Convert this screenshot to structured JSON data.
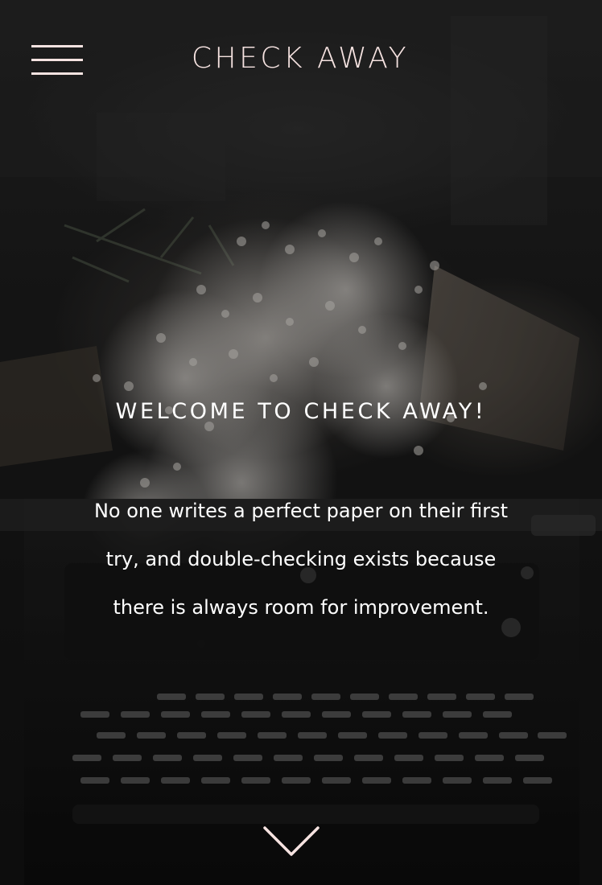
{
  "header": {
    "site_title": "CHECK AWAY",
    "menu_icon": "hamburger-menu-icon"
  },
  "hero": {
    "heading": "WELCOME TO CHECK AWAY!",
    "intro_lines": [
      "No one writes a perfect paper on their first",
      "try, and double-checking exists because",
      "there is always room for improvement."
    ],
    "scroll_icon": "chevron-down-icon"
  },
  "colors": {
    "accent_pink": "#f6e3e1",
    "hero_text": "#ffffff",
    "background_dark": "#141414"
  }
}
